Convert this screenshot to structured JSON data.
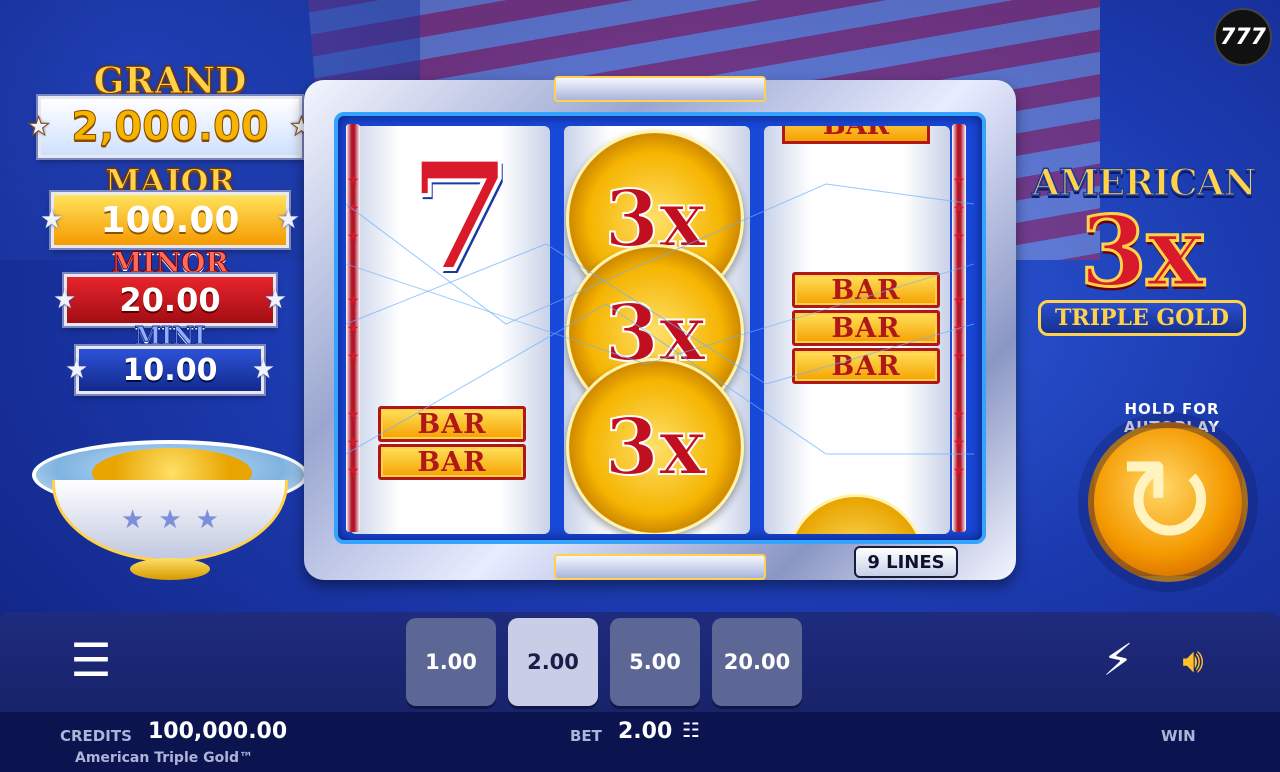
{
  "brand_logo": "777",
  "jackpots": {
    "grand": {
      "label": "GRAND",
      "value": "2,000.00"
    },
    "major": {
      "label": "MAJOR",
      "value": "100.00"
    },
    "minor": {
      "label": "MINOR",
      "value": "20.00"
    },
    "mini": {
      "label": "MINI",
      "value": "10.00"
    }
  },
  "reels": {
    "symbols": {
      "seven": "7",
      "bar": "BAR",
      "coin": "3x"
    },
    "lines_badge": "9 LINES"
  },
  "game_logo": {
    "top": "AMERICAN",
    "middle": "3x",
    "bottom": "TRIPLE GOLD"
  },
  "spin": {
    "autoplay_hint": "HOLD FOR AUTOPLAY",
    "icon": "spin-arrow-icon"
  },
  "controls": {
    "menu_icon": "hamburger-menu-icon",
    "bet_options": [
      "1.00",
      "2.00",
      "5.00",
      "20.00"
    ],
    "selected_bet": "2.00",
    "turbo_icon": "lightning-icon",
    "sound_icon": "speaker-icon"
  },
  "info": {
    "credits_label": "CREDITS",
    "credits_value": "100,000.00",
    "game_name": "American Triple Gold™",
    "bet_label": "BET",
    "bet_value": "2.00",
    "win_label": "WIN"
  },
  "colors": {
    "background": "#1c3bb0",
    "gold": "#ffd24a",
    "red": "#d81a2a",
    "bet_selected": "#c9cde6",
    "bet_default": "#5d6796"
  }
}
